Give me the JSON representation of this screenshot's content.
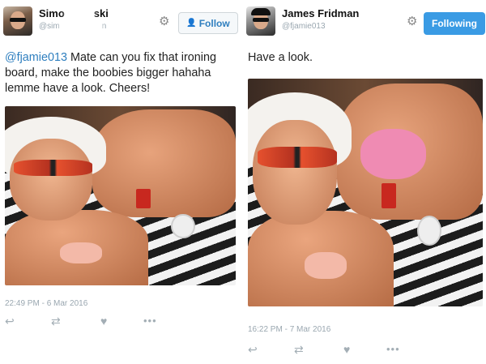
{
  "tweet1": {
    "display_name_left": "Simo",
    "display_name_right": "ski",
    "handle": "@sim",
    "handle_tail": "n",
    "follow_label": "Follow",
    "mention": "@fjamie013",
    "text": " Mate can you fix that ironing board, make the boobies bigger hahaha lemme have a look. Cheers!",
    "timestamp": "22:49 PM - 6 Mar 2016"
  },
  "tweet2": {
    "display_name": "James Fridman",
    "handle": "@fjamie013",
    "following_label": "Following",
    "text": "Have a look.",
    "timestamp": "16:22 PM - 7 Mar 2016"
  },
  "icons": {
    "settings": "⚙",
    "add_user": "👤",
    "reply": "↩",
    "retweet": "⇄",
    "like": "♥",
    "more": "•••"
  },
  "colors": {
    "accent": "#2f7fbf",
    "following_bg": "#3a9be4",
    "muted": "#9aa7b0"
  }
}
